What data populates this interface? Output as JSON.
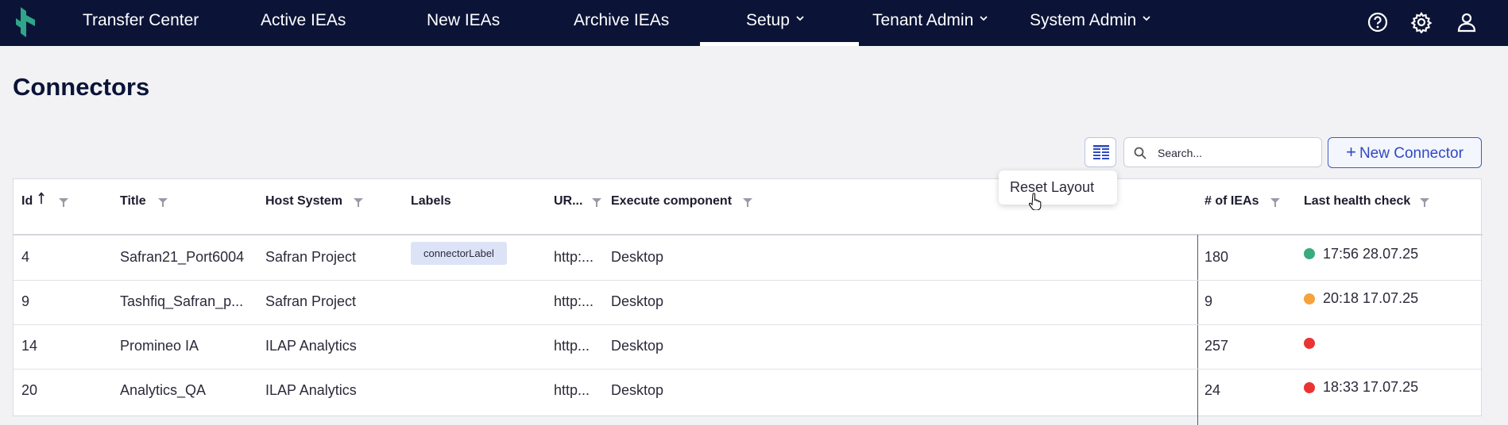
{
  "nav": {
    "items": [
      {
        "label": "Transfer Center"
      },
      {
        "label": "Active IEAs"
      },
      {
        "label": "New IEAs"
      },
      {
        "label": "Archive IEAs"
      },
      {
        "label": "Setup"
      },
      {
        "label": "Tenant Admin"
      },
      {
        "label": "System Admin"
      }
    ],
    "active": "Setup",
    "icons": [
      "help-icon",
      "gear-icon",
      "user-icon"
    ]
  },
  "page": {
    "title": "Connectors"
  },
  "toolbar": {
    "columns_icon": "column-layout-icon",
    "search_placeholder": "Search...",
    "new_button_plus": "+",
    "new_button_label": "New Connector"
  },
  "popover": {
    "reset_label": "Reset Layout"
  },
  "table": {
    "columns": [
      "Id",
      "Title",
      "Host System",
      "Labels",
      "UR...",
      "Execute component",
      "# of IEAs",
      "Last health check"
    ],
    "sort": {
      "column": "Id",
      "direction": "ascending"
    },
    "rows": [
      {
        "id": "4",
        "title": "Safran21_Port6004",
        "host": "Safran Project",
        "label": "connectorLabel",
        "url": "http:...",
        "exec": "Desktop",
        "ieas": "180",
        "health": "17:56 28.07.25",
        "status": "green"
      },
      {
        "id": "9",
        "title": "Tashfiq_Safran_p...",
        "host": "Safran Project",
        "label": "",
        "url": "http:...",
        "exec": "Desktop",
        "ieas": "9",
        "health": "20:18 17.07.25",
        "status": "orange"
      },
      {
        "id": "14",
        "title": "Promineo IA",
        "host": "ILAP Analytics",
        "label": "",
        "url": "http...",
        "exec": "Desktop",
        "ieas": "257",
        "health": "",
        "status": "red"
      },
      {
        "id": "20",
        "title": "Analytics_QA",
        "host": "ILAP Analytics",
        "label": "",
        "url": "http...",
        "exec": "Desktop",
        "ieas": "24",
        "health": "18:33 17.07.25",
        "status": "red"
      }
    ]
  },
  "colors": {
    "nav_bg": "#0b1437",
    "accent": "#2f49c2",
    "status_green": "#3aaa7f",
    "status_orange": "#f7a23c",
    "status_red": "#ea3434",
    "chip_bg": "#dde3f7"
  }
}
